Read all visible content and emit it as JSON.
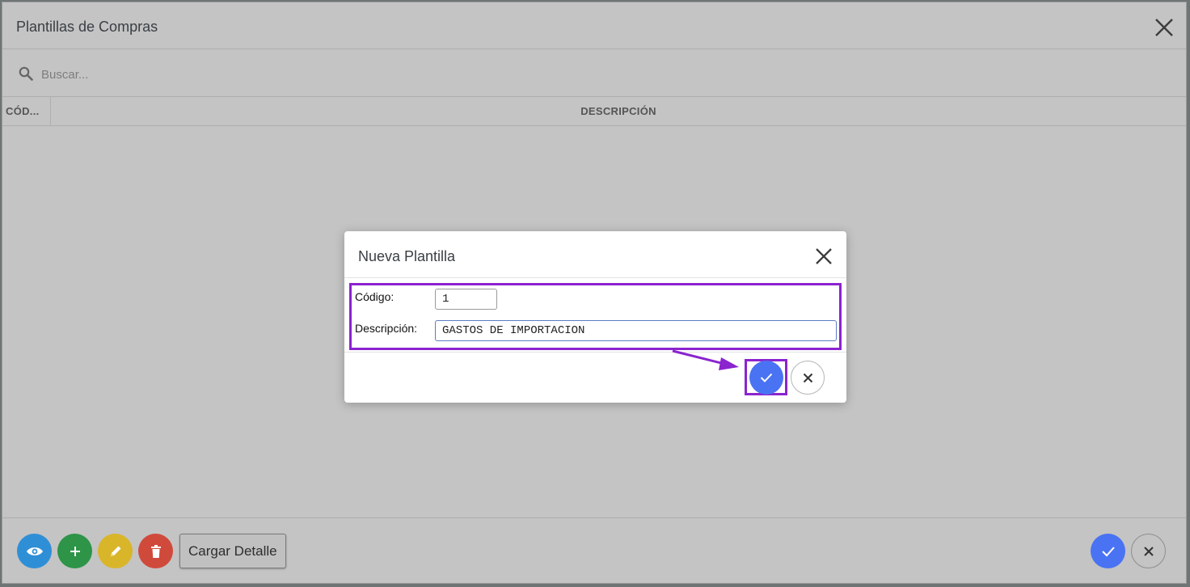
{
  "window": {
    "title": "Plantillas de Compras"
  },
  "search": {
    "placeholder": "Buscar..."
  },
  "table": {
    "columns": [
      "CÓD...",
      "DESCRIPCIÓN"
    ],
    "rows": []
  },
  "footer": {
    "buttons": [
      {
        "icon": "eye-icon",
        "color": "#2f8fd6"
      },
      {
        "icon": "plus-icon",
        "color": "#2e9448"
      },
      {
        "icon": "pencil-icon",
        "color": "#d9b52a"
      },
      {
        "icon": "trash-icon",
        "color": "#d04a3c"
      }
    ],
    "load_detail_label": "Cargar Detalle",
    "confirm_color": "#4a73f3"
  },
  "dialog": {
    "title": "Nueva Plantilla",
    "code_label": "Código:",
    "code_value": "1",
    "description_label": "Descripción:",
    "description_value": "GASTOS DE IMPORTACION",
    "highlight_color": "#8b23cf"
  }
}
